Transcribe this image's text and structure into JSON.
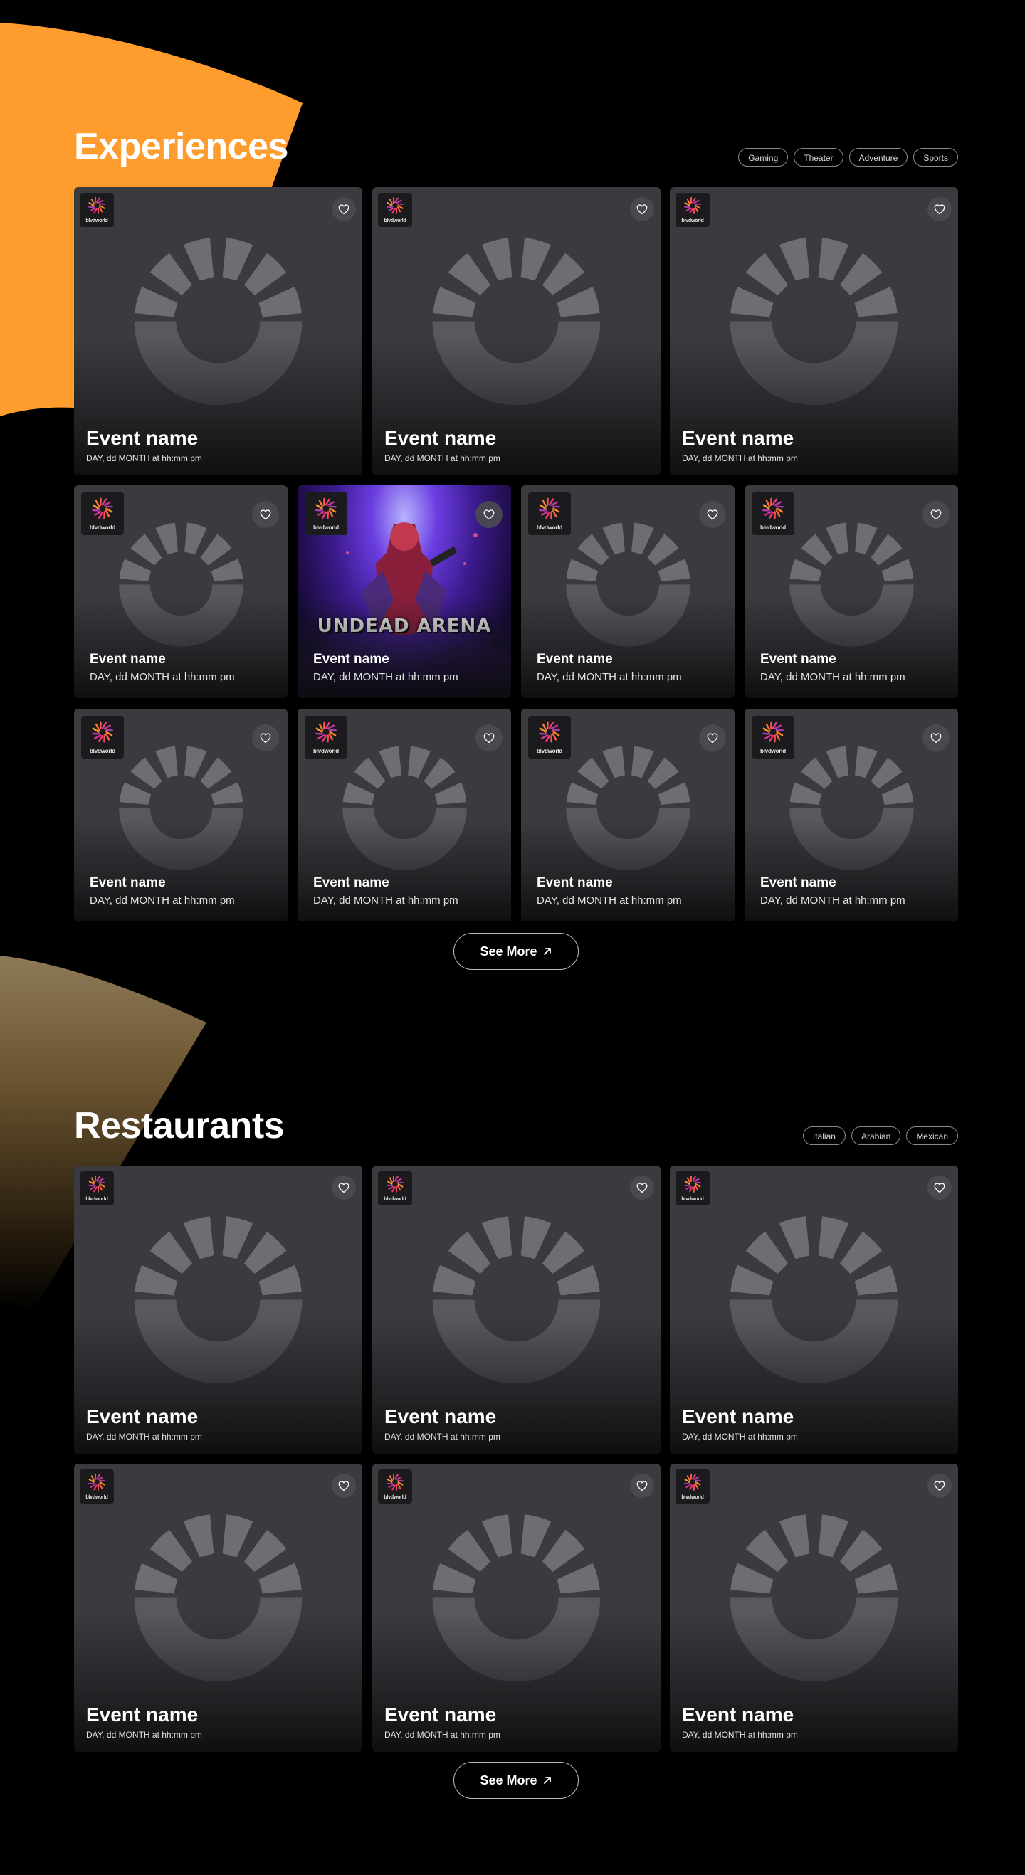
{
  "experiences": {
    "title": "Experiences",
    "filters": [
      "Gaming",
      "Theater",
      "Adventure",
      "Sports"
    ],
    "cards": [
      {
        "name": "Event name",
        "date": "DAY, dd MONTH at hh:mm pm",
        "logo_text": "blvdworld",
        "image": "placeholder"
      },
      {
        "name": "Event name",
        "date": "DAY, dd MONTH at hh:mm pm",
        "logo_text": "blvdworld",
        "image": "placeholder"
      },
      {
        "name": "Event name",
        "date": "DAY, dd MONTH at hh:mm pm",
        "logo_text": "blvdworld",
        "image": "placeholder"
      },
      {
        "name": "Event name",
        "date": "DAY, dd MONTH at hh:mm pm",
        "logo_text": "blvdworld",
        "image": "placeholder"
      },
      {
        "name": "Event name",
        "date": "DAY, dd MONTH at hh:mm pm",
        "logo_text": "blvdworld",
        "image": "poster",
        "poster_text": "UNDEAD ARENA"
      },
      {
        "name": "Event name",
        "date": "DAY, dd MONTH at hh:mm pm",
        "logo_text": "blvdworld",
        "image": "placeholder"
      },
      {
        "name": "Event name",
        "date": "DAY, dd MONTH at hh:mm pm",
        "logo_text": "blvdworld",
        "image": "placeholder"
      },
      {
        "name": "Event name",
        "date": "DAY, dd MONTH at hh:mm pm",
        "logo_text": "blvdworld",
        "image": "placeholder"
      },
      {
        "name": "Event name",
        "date": "DAY, dd MONTH at hh:mm pm",
        "logo_text": "blvdworld",
        "image": "placeholder"
      },
      {
        "name": "Event name",
        "date": "DAY, dd MONTH at hh:mm pm",
        "logo_text": "blvdworld",
        "image": "placeholder"
      },
      {
        "name": "Event name",
        "date": "DAY, dd MONTH at hh:mm pm",
        "logo_text": "blvdworld",
        "image": "placeholder"
      }
    ],
    "see_more": "See More"
  },
  "restaurants": {
    "title": "Restaurants",
    "filters": [
      "Italian",
      "Arabian",
      "Mexican"
    ],
    "cards": [
      {
        "name": "Event name",
        "date": "DAY, dd MONTH at hh:mm pm",
        "logo_text": "blvdworld",
        "image": "placeholder"
      },
      {
        "name": "Event name",
        "date": "DAY, dd MONTH at hh:mm pm",
        "logo_text": "blvdworld",
        "image": "placeholder"
      },
      {
        "name": "Event name",
        "date": "DAY, dd MONTH at hh:mm pm",
        "logo_text": "blvdworld",
        "image": "placeholder"
      },
      {
        "name": "Event name",
        "date": "DAY, dd MONTH at hh:mm pm",
        "logo_text": "blvdworld",
        "image": "placeholder"
      },
      {
        "name": "Event name",
        "date": "DAY, dd MONTH at hh:mm pm",
        "logo_text": "blvdworld",
        "image": "placeholder"
      },
      {
        "name": "Event name",
        "date": "DAY, dd MONTH at hh:mm pm",
        "logo_text": "blvdworld",
        "image": "placeholder"
      }
    ],
    "see_more": "See More"
  },
  "icons": {
    "favorite": "heart-icon",
    "see_more": "arrow-up-right-icon",
    "placeholder": "loading-spinner-icon",
    "logo": "blvdworld-logo"
  },
  "colors": {
    "background": "#000000",
    "accent_orange": "#ff9c2e",
    "card": "#3a3a3f",
    "placeholder_light": "#6d6d72",
    "placeholder_dark": "#58585d"
  }
}
